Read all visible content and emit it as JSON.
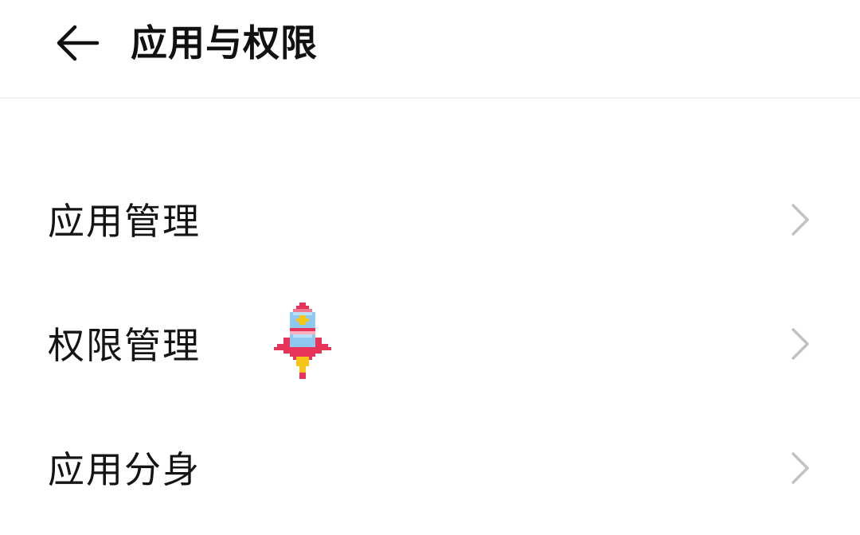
{
  "header": {
    "back_icon": "back-arrow-icon",
    "title": "应用与权限"
  },
  "menu": {
    "items": [
      {
        "label": "应用管理",
        "icon": "chevron-right-icon"
      },
      {
        "label": "权限管理",
        "icon": "chevron-right-icon"
      },
      {
        "label": "应用分身",
        "icon": "chevron-right-icon"
      }
    ]
  },
  "overlay": {
    "icon": "pixel-rocket-icon"
  },
  "colors": {
    "background": "#ffffff",
    "text": "#141414",
    "chevron": "#c2c2c2",
    "divider": "#f0f0f0",
    "rocket_body": "#8ec8f0",
    "rocket_fin": "#e8345a",
    "rocket_flame": "#f5c518"
  }
}
